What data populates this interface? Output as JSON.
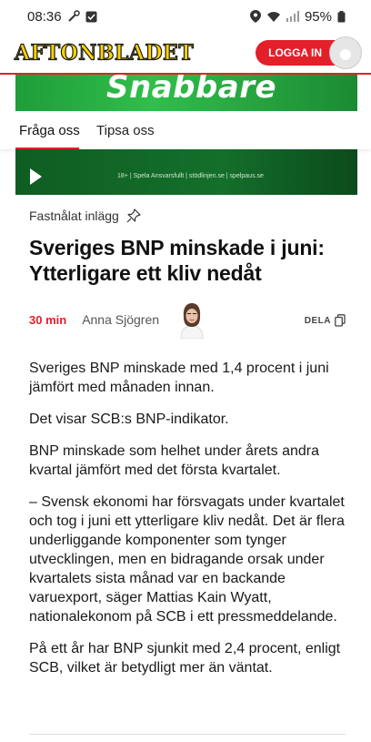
{
  "status_bar": {
    "time": "08:36",
    "battery": "95%"
  },
  "header": {
    "logo": "AFTONBLADET",
    "login_label": "LOGGA IN"
  },
  "ad": {
    "slogan": "Snabbare",
    "fine_print": "18+  |  Spela Ansvarsfullt  |  stödlinjen.se  |  spelpaus.se"
  },
  "subnav": {
    "tabs": [
      {
        "label": "Fråga oss"
      },
      {
        "label": "Tipsa oss"
      }
    ]
  },
  "article": {
    "pinned_label": "Fastnålat inlägg",
    "headline": "Sveriges BNP minskade i juni: Ytterligare ett kliv nedåt",
    "time_ago": "30 min",
    "author": "Anna Sjögren",
    "share_label": "DELA",
    "paragraphs": [
      "Sveriges BNP minskade med 1,4 procent i juni jämfört med månaden innan.",
      "Det visar SCB:s BNP-indikator.",
      "BNP minskade som helhet under årets andra kvartal jämfört med det första kvartalet.",
      "– Svensk ekonomi har försvagats under kvartalet och tog i juni ett ytterligare kliv nedåt. Det är flera underliggande komponenter som tynger utvecklingen, men en bidragande orsak under kvartalets sista månad var en backande varuexport, säger Mattias Kain Wyatt, nationalekonom på SCB i ett pressmeddelande.",
      "På ett år har BNP sjunkit med 2,4 procent, enligt SCB, vilket är betydligt mer än väntat."
    ]
  },
  "colors": {
    "brand_red": "#e3202a",
    "logo_yellow": "#ffd400",
    "ad_green": "#2fbf4a"
  }
}
